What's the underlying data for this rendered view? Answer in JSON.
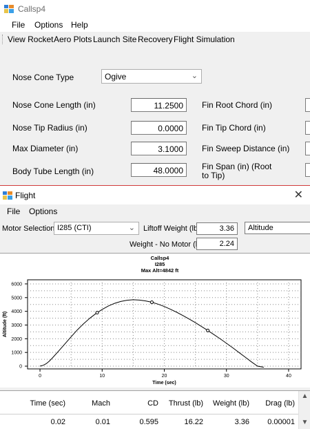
{
  "main_window": {
    "title": "Callsp4",
    "menu": [
      "File",
      "Options",
      "Help"
    ],
    "tabs": [
      "View Rocket",
      "Aero Plots",
      "Launch Site",
      "Recovery",
      "Flight Simulation"
    ],
    "nose_cone_type": {
      "label": "Nose Cone Type",
      "value": "Ogive"
    },
    "fields_left": [
      {
        "label": "Nose Cone Length (in)",
        "value": "11.2500"
      },
      {
        "label": "Nose Tip Radius (in)",
        "value": "0.0000"
      },
      {
        "label": "Max Diameter (in)",
        "value": "3.1000"
      },
      {
        "label": "Body Tube Length (in)",
        "value": "48.0000"
      }
    ],
    "fields_right": [
      {
        "label": "Fin Root Chord (in)"
      },
      {
        "label": "Fin Tip Chord (in)"
      },
      {
        "label": "Fin Sweep Distance (in)"
      },
      {
        "label_line1": "Fin Span (in)  (Root",
        "label_line2": "to Tip)"
      }
    ]
  },
  "flight_window": {
    "title": "Flight",
    "close_glyph": "✕",
    "menu": [
      "File",
      "Options"
    ],
    "motor_selection": {
      "label": "Motor Selection",
      "value": "I285  (CTI)"
    },
    "liftoff_weight": {
      "label": "Liftoff Weight (lb)",
      "value": "3.36"
    },
    "weight_no_motor": {
      "label": "Weight - No Motor (lb)",
      "value": "2.24"
    },
    "plot_select": "Altitude",
    "table": {
      "headers": [
        "Time (sec)",
        "Mach",
        "CD",
        "Thrust (lb)",
        "Weight (lb)",
        "Drag (lb)"
      ],
      "row": [
        "0.02",
        "0.01",
        "0.595",
        "16.22",
        "3.36",
        "0.00001"
      ]
    }
  },
  "chart_data": {
    "type": "line",
    "title_lines": [
      "Callsp4",
      "I285",
      "Max Alt=4842 ft"
    ],
    "xlabel": "Time (sec)",
    "ylabel": "Altitude (ft)",
    "xlim": [
      -2,
      42
    ],
    "ylim": [
      -200,
      6300
    ],
    "x_ticks": [
      0,
      10,
      20,
      30,
      40
    ],
    "y_ticks": [
      0,
      1000,
      2000,
      3000,
      4000,
      5000,
      6000
    ],
    "grid": true,
    "series": [
      {
        "x": [
          0,
          0.5,
          1,
          1.5,
          2,
          3,
          4,
          5,
          6,
          7,
          8,
          9,
          10,
          11,
          12,
          13,
          14,
          15,
          16,
          17,
          18,
          19,
          20,
          21,
          22,
          23,
          24,
          25,
          26,
          27,
          28,
          29,
          30,
          31,
          32,
          33,
          34,
          35,
          36
        ],
        "y": [
          0,
          60,
          180,
          370,
          600,
          1100,
          1620,
          2140,
          2640,
          3090,
          3490,
          3840,
          4140,
          4390,
          4580,
          4720,
          4810,
          4842,
          4820,
          4760,
          4660,
          4520,
          4350,
          4150,
          3930,
          3690,
          3440,
          3170,
          2890,
          2600,
          2300,
          1990,
          1670,
          1340,
          1000,
          660,
          320,
          0,
          -80
        ]
      }
    ],
    "markers_x": [
      9.2,
      18,
      27
    ]
  }
}
